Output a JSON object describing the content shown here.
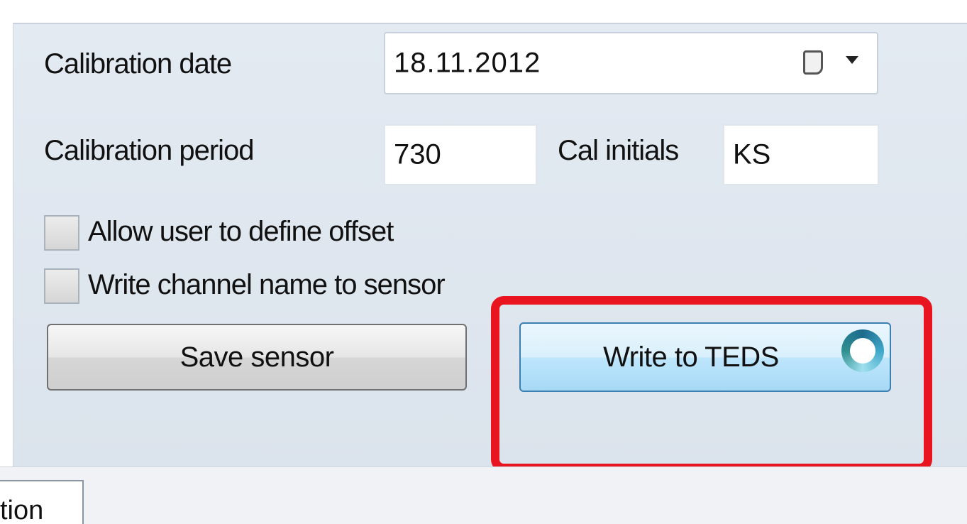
{
  "form": {
    "calibration_date_label": "Calibration date",
    "calibration_date_value": "18.11.2012",
    "calibration_period_label": "Calibration period",
    "calibration_period_value": "730",
    "cal_initials_label": "Cal initials",
    "cal_initials_value": "KS",
    "allow_offset_label": "Allow user to define offset",
    "allow_offset_checked": false,
    "write_channel_label": "Write channel name to sensor",
    "write_channel_checked": false
  },
  "buttons": {
    "save_label": "Save sensor",
    "write_teds_label": "Write to TEDS"
  },
  "icons": {
    "date_picker": "calendar-icon",
    "dropdown": "chevron-down-icon",
    "busy": "busy-spinner-icon"
  },
  "tabs": {
    "partial_label": "tion"
  },
  "colors": {
    "highlight": "#e8141f",
    "teds_button_border": "#3c7fb1"
  }
}
